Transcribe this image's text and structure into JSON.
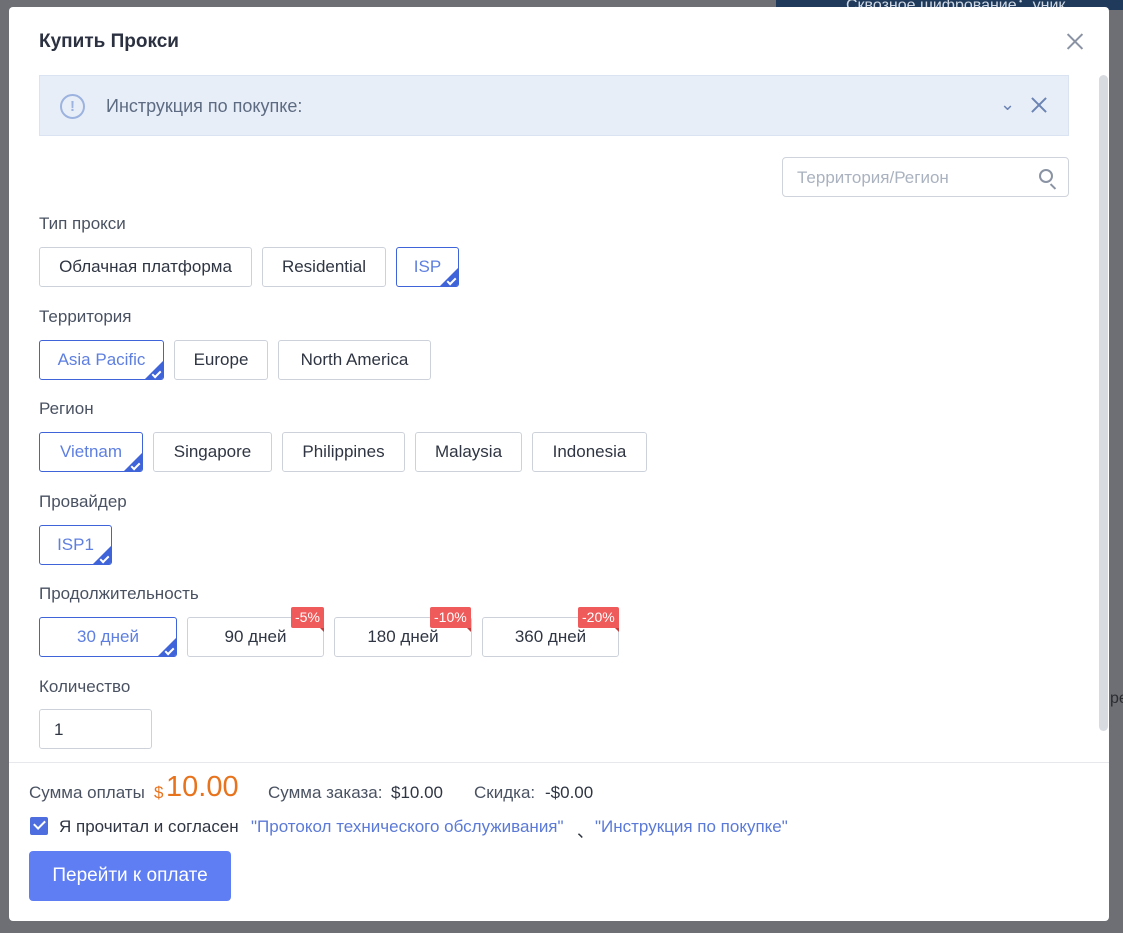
{
  "background": {
    "banner_text": "Сквозное шифрование：уник",
    "edge_text": "ре"
  },
  "modal": {
    "title": "Купить Прокси",
    "notice": {
      "text": "Инструкция по покупке:"
    },
    "search": {
      "placeholder": "Территория/Регион",
      "value": ""
    },
    "proxy_type": {
      "label": "Тип прокси",
      "options": [
        "Облачная платформа",
        "Residential",
        "ISP"
      ],
      "selected": "ISP"
    },
    "territory": {
      "label": "Территория",
      "options": [
        "Asia Pacific",
        "Europe",
        "North America"
      ],
      "selected": "Asia Pacific"
    },
    "region": {
      "label": "Регион",
      "options": [
        "Vietnam",
        "Singapore",
        "Philippines",
        "Malaysia",
        "Indonesia"
      ],
      "selected": "Vietnam"
    },
    "provider": {
      "label": "Провайдер",
      "options": [
        "ISP1"
      ],
      "selected": "ISP1"
    },
    "duration": {
      "label": "Продолжительность",
      "options": [
        {
          "label": "30 дней",
          "discount": ""
        },
        {
          "label": "90 дней",
          "discount": "-5%"
        },
        {
          "label": "180 дней",
          "discount": "-10%"
        },
        {
          "label": "360 дней",
          "discount": "-20%"
        }
      ],
      "selected": "30 дней"
    },
    "quantity": {
      "label": "Количество",
      "value": "1"
    },
    "summary": {
      "pay_label": "Сумма оплаты",
      "currency": "$",
      "pay_amount": "10.00",
      "order_label": "Сумма заказа:",
      "order_value": "$10.00",
      "discount_label": "Скидка:",
      "discount_value": "-$0.00"
    },
    "agreement": {
      "checked": true,
      "text": "Я прочитал и согласен",
      "link1": "\"Протокол технического обслуживания\"",
      "separator": "、",
      "link2": "\"Инструкция по покупке\""
    },
    "pay_button": "Перейти к оплате"
  },
  "colors": {
    "accent": "#3f63d9",
    "button": "#5f7ef4",
    "price": "#e8731d",
    "discount_badge": "#ef5b5b"
  },
  "icons": [
    "close-icon",
    "info-icon",
    "chevron-down-icon",
    "search-icon",
    "check-icon"
  ]
}
